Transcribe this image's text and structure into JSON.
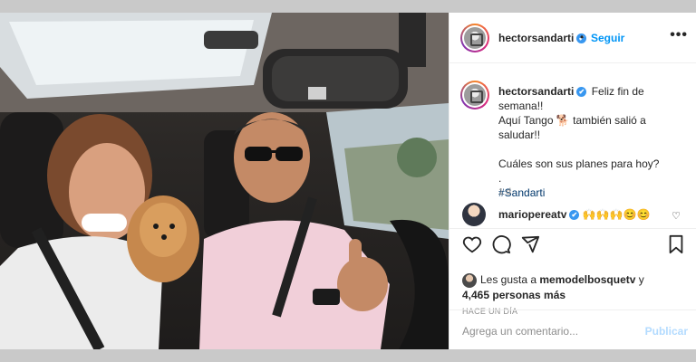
{
  "post": {
    "username": "hectorsandarti",
    "verified_mark": "✔",
    "separator": "•",
    "follow_label": "Seguir",
    "more_label": "•••",
    "caption_lines": [
      "Feliz fin de semana!!",
      "Aquí Tango 🐕 también salió a saludar!!",
      "Cuáles son sus planes para hoy?",
      ".",
      "#Sandarti"
    ],
    "caption_time": "1 d"
  },
  "comment": {
    "username": "mariopereatv",
    "text": "🙌🙌🙌😊😊",
    "like_icon": "♡"
  },
  "engagement": {
    "liked_by_prefix": "Les gusta a",
    "liked_by_user": "memodelbosquetv",
    "liked_by_conj": "y",
    "others": "4,465 personas más",
    "time_ago": "HACE UN DÍA"
  },
  "composer": {
    "placeholder": "Agrega un comentario...",
    "publish_label": "Publicar"
  },
  "icons": [
    "heart-icon",
    "comment-icon",
    "share-icon",
    "bookmark-icon"
  ],
  "colors": {
    "link": "#0095f6",
    "hashtag": "#00376b",
    "muted": "#8e8e8e",
    "publish_disabled": "#b3dbff"
  }
}
